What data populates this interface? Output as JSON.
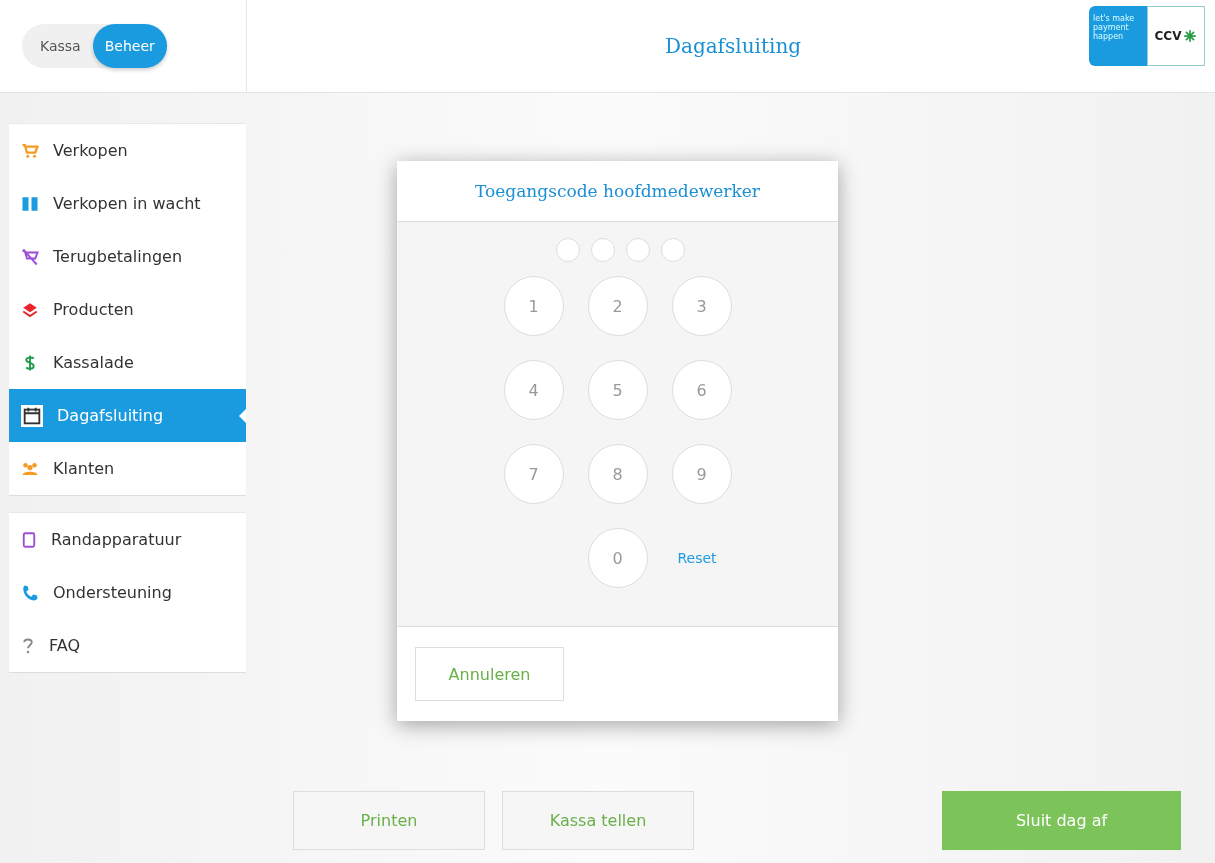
{
  "mode_toggle": [
    {
      "label": "Kassa",
      "selected": false
    },
    {
      "label": "Beheer",
      "selected": true
    }
  ],
  "header": {
    "title": "Dagafsluiting",
    "logo_tagline": "let's make payment happen",
    "logo_brand": "CCV"
  },
  "sidebar": {
    "groups": [
      [
        {
          "kind": "cart",
          "label": "Verkopen",
          "selected": false
        },
        {
          "kind": "pause",
          "label": "Verkopen in wacht",
          "selected": false
        },
        {
          "kind": "refund",
          "label": "Terugbetalingen",
          "selected": false
        },
        {
          "kind": "layers",
          "label": "Producten",
          "selected": false
        },
        {
          "kind": "dollar",
          "label": "Kassalade",
          "selected": false
        },
        {
          "kind": "calendar",
          "label": "Dagafsluiting",
          "selected": true
        },
        {
          "kind": "people",
          "label": "Klanten",
          "selected": false
        }
      ],
      [
        {
          "kind": "tablet",
          "label": "Randapparatuur",
          "selected": false
        },
        {
          "kind": "phone",
          "label": "Ondersteuning",
          "selected": false
        },
        {
          "kind": "question",
          "label": "FAQ",
          "selected": false
        }
      ]
    ]
  },
  "dialog": {
    "title": "Toegangscode hoofdmedewerker",
    "pin_dots": [
      {
        "filled": false
      },
      {
        "filled": false
      },
      {
        "filled": false
      },
      {
        "filled": false
      }
    ],
    "keys": [
      "1",
      "2",
      "3",
      "4",
      "5",
      "6",
      "7",
      "8",
      "9",
      "0"
    ],
    "reset": "Reset",
    "cancel": "Annuleren"
  },
  "actions": [
    {
      "label": "Printen",
      "kind": "secondary"
    },
    {
      "label": "Kassa tellen",
      "kind": "secondary"
    },
    {
      "label": "Sluit dag af",
      "kind": "primary"
    }
  ]
}
